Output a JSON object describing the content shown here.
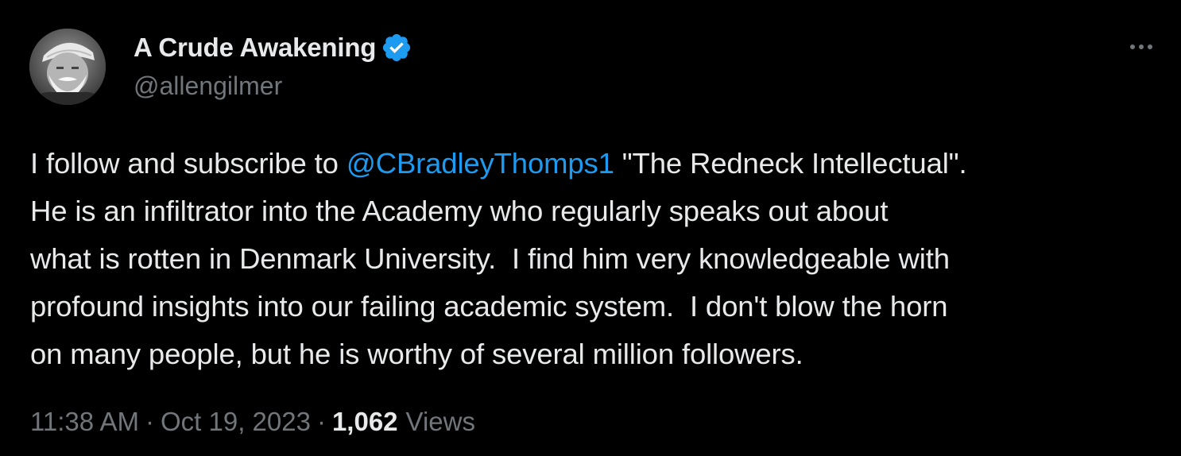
{
  "author": {
    "display_name": "A Crude Awakening",
    "handle": "@allengilmer",
    "verified_badge_icon": "verified-check-icon",
    "badge_color": "#1d9bf0"
  },
  "more_button_icon": "more-horizontal-icon",
  "tweet": {
    "text_before_mention": "I follow and subscribe to ",
    "mention": "@CBradleyThomps1",
    "text_after_mention": " \"The Redneck Intellectual\".\nHe is an infiltrator into the Academy who regularly speaks out about\nwhat is rotten in Denmark University.  I find him very knowledgeable with\nprofound insights into our failing academic system.  I don't blow the horn\non many people, but he is worthy of several million followers."
  },
  "meta": {
    "time": "11:38 AM",
    "separator": "·",
    "date": "Oct 19, 2023",
    "views_count": "1,062",
    "views_label": "Views"
  },
  "colors": {
    "background": "#000000",
    "text_primary": "#e7e9ea",
    "text_secondary": "#71767b",
    "link": "#1d9bf0"
  }
}
